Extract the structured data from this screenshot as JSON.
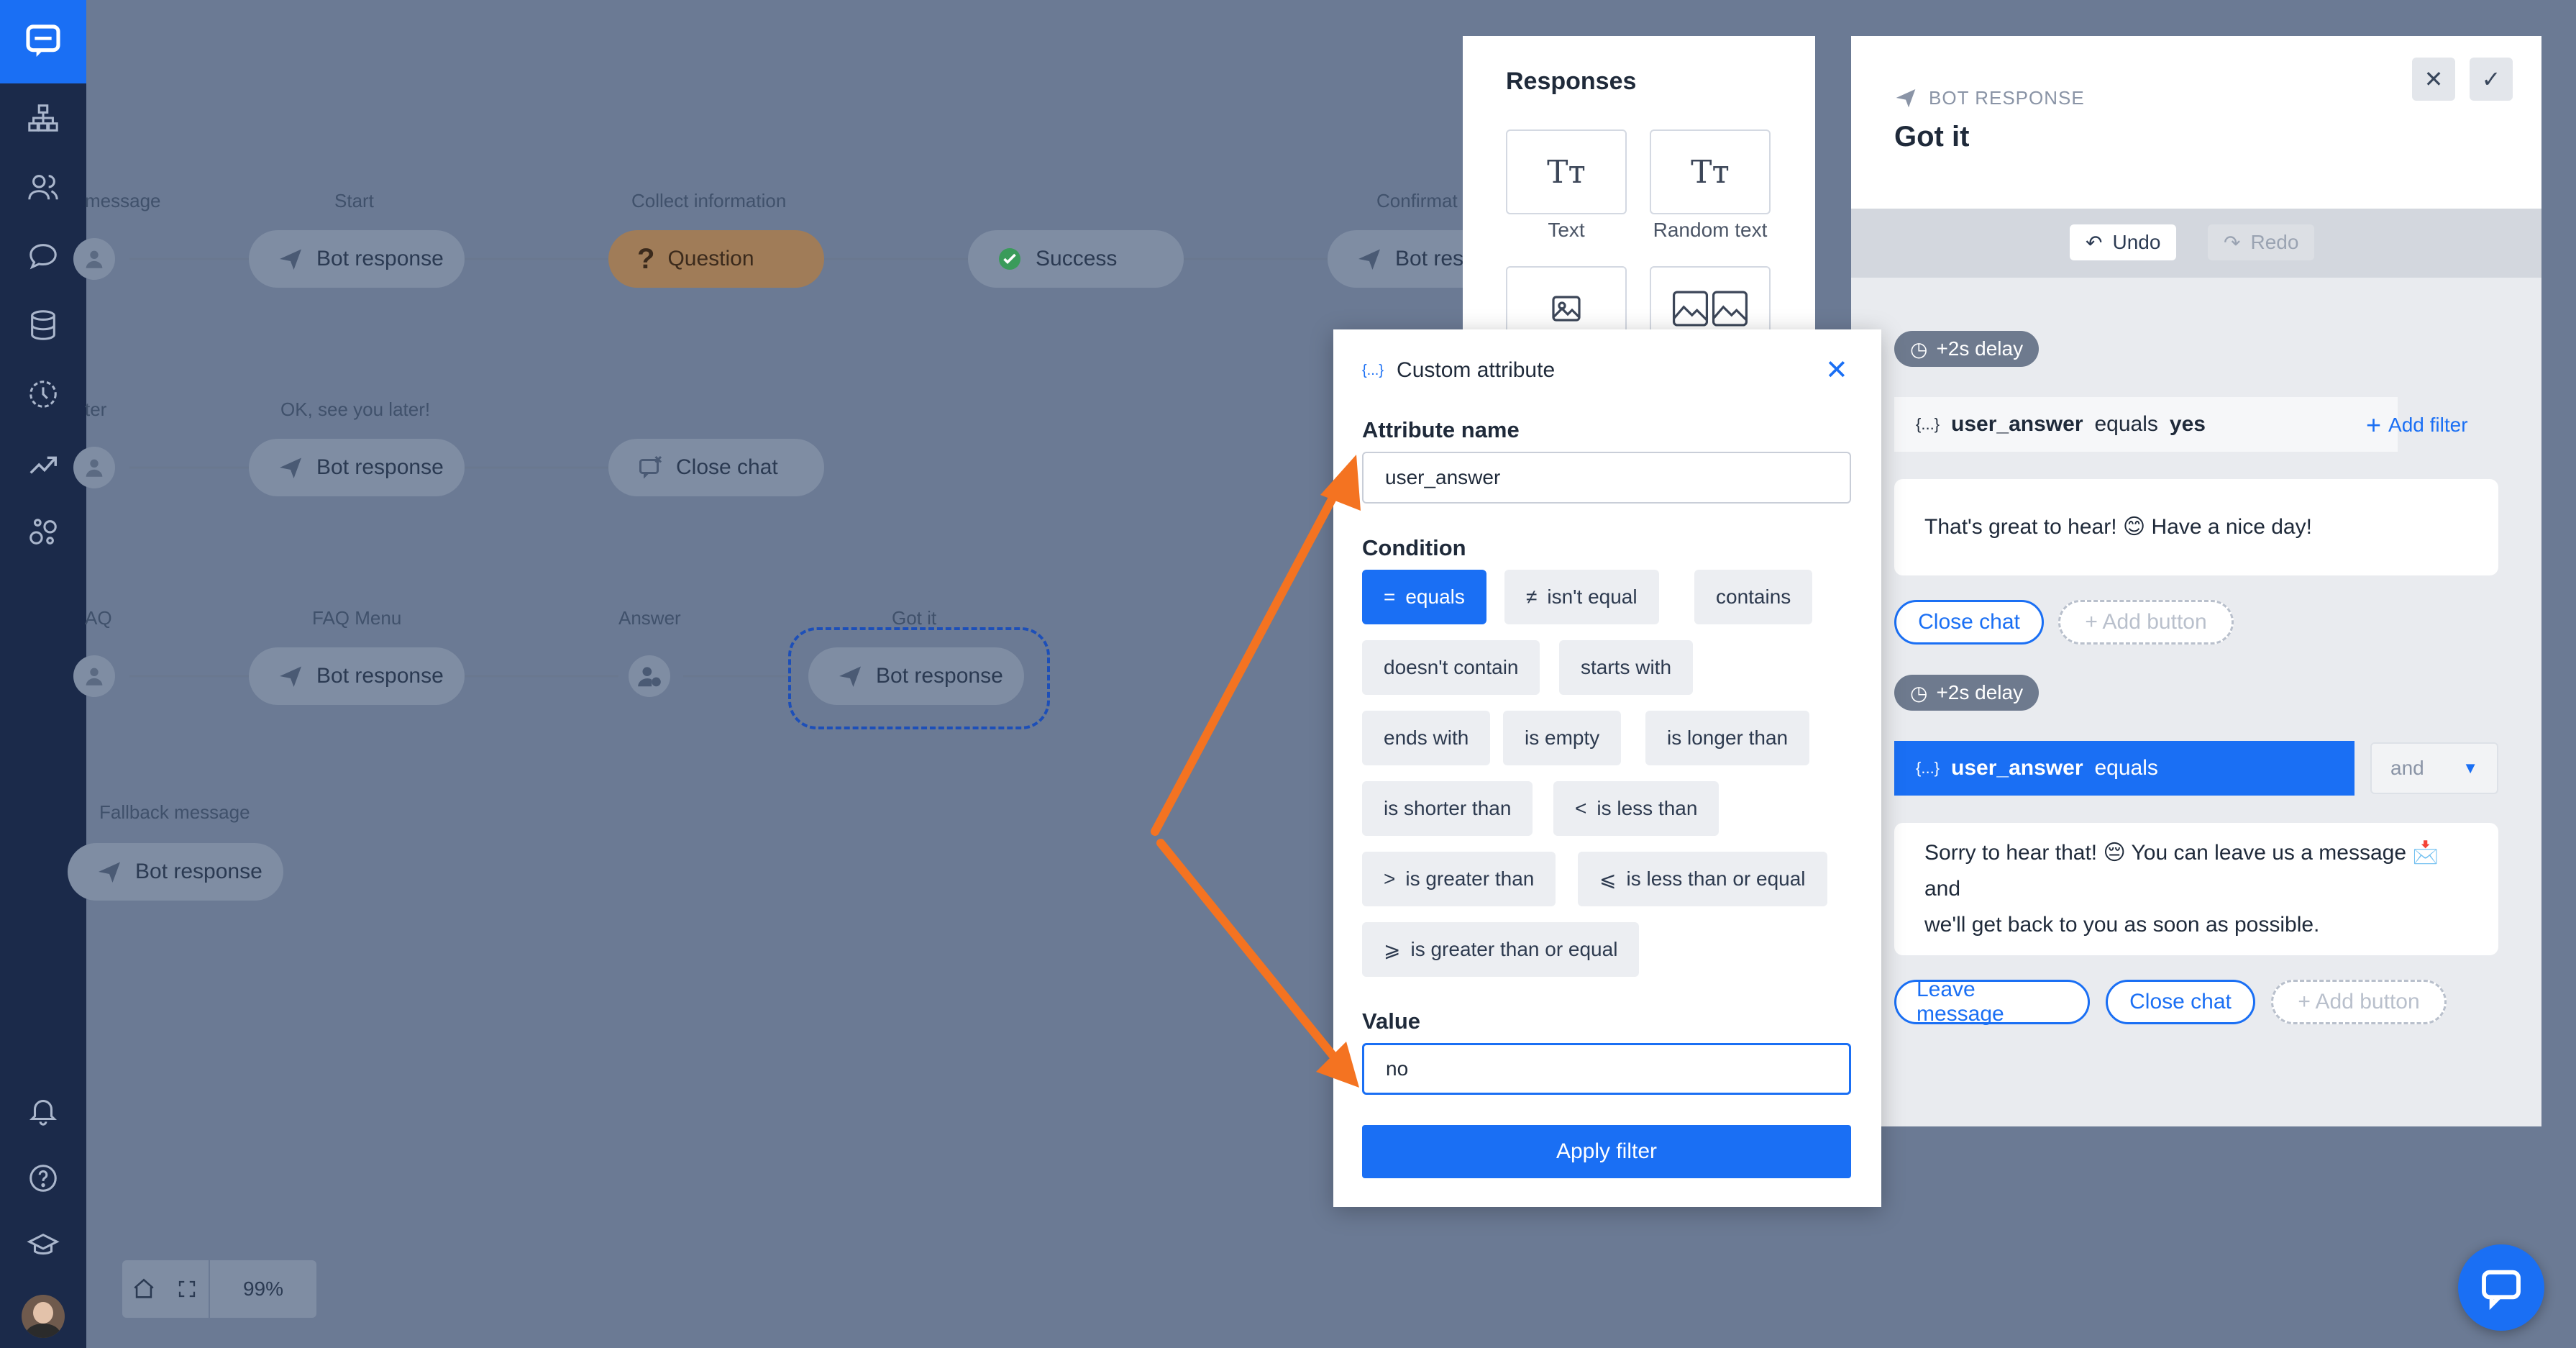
{
  "canvas": {
    "columns": {
      "message": "message",
      "start": "Start",
      "collect": "Collect information",
      "confirm": "Confirmat",
      "later": "ter",
      "see_you": "OK, see you later!",
      "faq": "AQ",
      "faq_menu": "FAQ Menu",
      "answer": "Answer",
      "got_it": "Got it",
      "fallback": "Fallback message"
    },
    "nodes": {
      "bot_response": "Bot response",
      "question": "Question",
      "success": "Success",
      "bot_resp_partial": "Bot resp",
      "close_chat": "Close chat"
    },
    "zoom": "99%"
  },
  "responses": {
    "title": "Responses",
    "tiles": [
      "Text",
      "Random text"
    ]
  },
  "bot_panel": {
    "kicker": "BOT RESPONSE",
    "title": "Got it",
    "undo": "Undo",
    "redo": "Redo",
    "blocks": [
      {
        "delay": "+2s delay",
        "filter_attr": "user_answer",
        "filter_op": "equals",
        "filter_value": "yes",
        "add_filter": "Add filter",
        "message": "That's great to hear! 😊 Have a nice day!",
        "buttons": [
          "Close chat"
        ],
        "add_button": "+ Add button"
      },
      {
        "delay": "+2s delay",
        "filter_attr": "user_answer",
        "filter_op": "equals",
        "logic": "and",
        "message_line1": "Sorry to hear that! 😔 You can leave us a message 📩 and",
        "message_line2": "we'll get back to you as soon as possible.",
        "buttons": [
          "Leave message",
          "Close chat"
        ],
        "add_button": "+ Add button"
      }
    ]
  },
  "modal": {
    "title": "Custom attribute",
    "attr_label": "Attribute name",
    "attr_value": "user_answer",
    "condition_label": "Condition",
    "conditions": [
      {
        "symbol": "=",
        "label": "equals"
      },
      {
        "symbol": "≠",
        "label": "isn't equal"
      },
      {
        "symbol": "",
        "label": "contains"
      },
      {
        "symbol": "",
        "label": "doesn't contain"
      },
      {
        "symbol": "",
        "label": "starts with"
      },
      {
        "symbol": "",
        "label": "ends with"
      },
      {
        "symbol": "",
        "label": "is empty"
      },
      {
        "symbol": "",
        "label": "is longer than"
      },
      {
        "symbol": "",
        "label": "is shorter than"
      },
      {
        "symbol": "<",
        "label": "is less than"
      },
      {
        "symbol": ">",
        "label": "is greater than"
      },
      {
        "symbol": "⩽",
        "label": "is less than or equal"
      },
      {
        "symbol": "⩾",
        "label": "is greater than or equal"
      }
    ],
    "selected_condition": "equals",
    "value_label": "Value",
    "value": "no",
    "apply": "Apply filter"
  },
  "colors": {
    "accent": "#1a6ff4",
    "sidebar": "#1b2a4a",
    "overlay": "#6b7a94",
    "arrow": "#f47321"
  }
}
